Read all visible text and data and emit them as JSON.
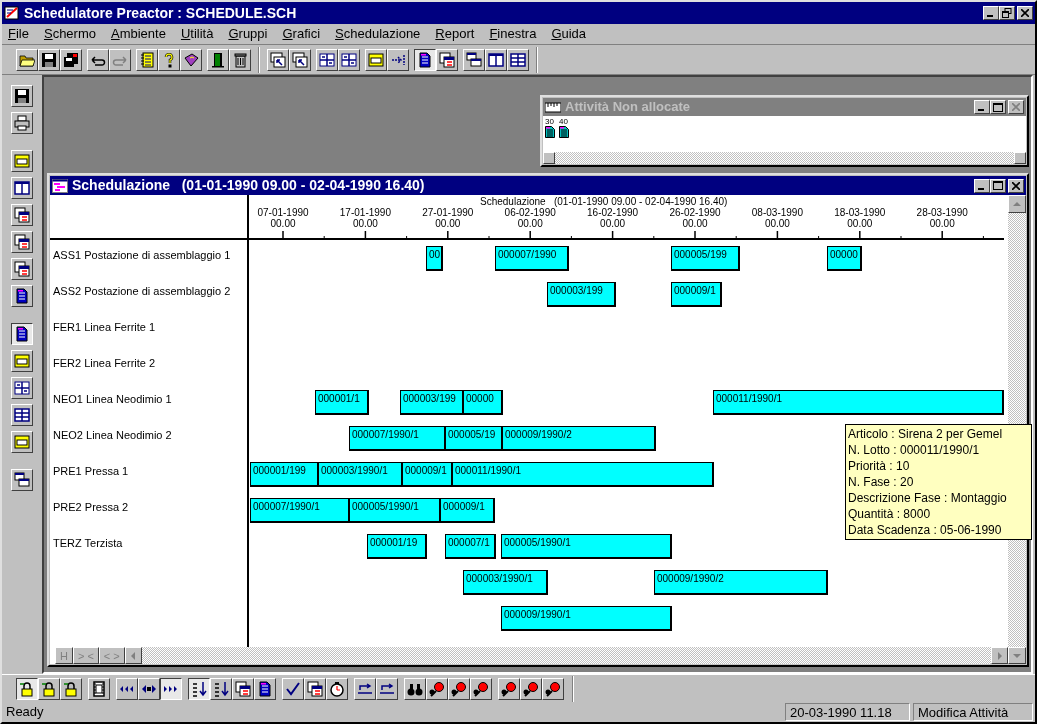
{
  "window": {
    "title": "Schedulatore Preactor : SCHEDULE.SCH"
  },
  "menu": [
    "File",
    "Schermo",
    "Ambiente",
    "Utilità",
    "Gruppi",
    "Grafici",
    "Schedulazione",
    "Report",
    "Finestra",
    "Guida"
  ],
  "toolbar": [
    {
      "pressed": false
    },
    {
      "pressed": false
    },
    {
      "pressed": false
    },
    {
      "pressed": false
    },
    {
      "pressed": false
    },
    {
      "pressed": false
    },
    {
      "pressed": false
    },
    {
      "pressed": false
    },
    {
      "pressed": false
    },
    {
      "pressed": false
    },
    {
      "pressed": false
    },
    {
      "pressed": false
    },
    {
      "pressed": false
    },
    {
      "pressed": false
    },
    {
      "pressed": false
    },
    {
      "pressed": false
    },
    {
      "pressed": true
    },
    {
      "pressed": false
    },
    {
      "pressed": false
    },
    {
      "pressed": false
    },
    {
      "pressed": false
    }
  ],
  "side_toolbar": [
    {
      "pressed": false
    },
    {
      "pressed": false
    },
    {
      "pressed": false
    },
    {
      "pressed": false
    },
    {
      "pressed": false
    },
    {
      "pressed": false
    },
    {
      "pressed": false
    },
    {
      "pressed": false
    },
    {
      "pressed": true
    },
    {
      "pressed": false
    },
    {
      "pressed": false
    },
    {
      "pressed": false
    },
    {
      "pressed": false
    },
    {
      "pressed": false
    }
  ],
  "unallocated_window": {
    "title": "Attività Non allocate",
    "items": [
      {
        "label": "30"
      },
      {
        "label": "40"
      }
    ]
  },
  "schedule_window": {
    "title": "Schedulazione   (01-01-1990 09.00 - 02-04-1990 16.40)",
    "timeline_title": "Schedulazione   (01-01-1990 09.00 - 02-04-1990 16.40)",
    "dates": [
      {
        "date": "07-01-1990",
        "time": "00.00"
      },
      {
        "date": "17-01-1990",
        "time": "00.00"
      },
      {
        "date": "27-01-1990",
        "time": "00.00"
      },
      {
        "date": "06-02-1990",
        "time": "00.00"
      },
      {
        "date": "16-02-1990",
        "time": "00.00"
      },
      {
        "date": "26-02-1990",
        "time": "00.00"
      },
      {
        "date": "08-03-1990",
        "time": "00.00"
      },
      {
        "date": "18-03-1990",
        "time": "00.00"
      },
      {
        "date": "28-03-1990",
        "time": "00.00"
      }
    ],
    "lanes": [
      {
        "resource": "ASS1 Postazione di assemblaggio 1",
        "bars": [
          {
            "label": "00"
          },
          {
            "label": "000007/1990"
          },
          {
            "label": "000005/199"
          },
          {
            "label": "00000"
          }
        ]
      },
      {
        "resource": "ASS2 Postazione di assemblaggio 2",
        "bars": [
          {
            "label": "000003/199"
          },
          {
            "label": "000009/1"
          }
        ]
      },
      {
        "resource": "FER1 Linea Ferrite 1"
      },
      {
        "resource": "FER2 Linea Ferrite 2"
      },
      {
        "resource": "NEO1 Linea Neodimio 1",
        "bars": [
          {
            "label": "000001/1"
          },
          {
            "label": "000003/199"
          },
          {
            "label": "00000"
          },
          {
            "label": "000011/1990/1"
          }
        ]
      },
      {
        "resource": "NEO2 Linea Neodimio 2",
        "bars": [
          {
            "label": "000007/1990/1"
          },
          {
            "label": "000005/19"
          },
          {
            "label": "000009/1990/2"
          }
        ]
      },
      {
        "resource": "PRE1 Pressa 1",
        "bars": [
          {
            "label": "000001/199"
          },
          {
            "label": "000003/1990/1"
          },
          {
            "label": "000009/1"
          },
          {
            "label": "000011/1990/1"
          }
        ]
      },
      {
        "resource": "PRE2 Pressa 2",
        "bars": [
          {
            "label": "000007/1990/1"
          },
          {
            "label": "000005/1990/1"
          },
          {
            "label": "000009/1"
          }
        ]
      },
      {
        "resource": "TERZ Terzista",
        "bars": [
          {
            "label": "000001/19"
          },
          {
            "label": "000007/1"
          },
          {
            "label": "000005/1990/1"
          }
        ]
      },
      {
        "bars": [
          {
            "label": "000003/1990/1"
          },
          {
            "label": "000009/1990/2"
          }
        ]
      },
      {
        "bars": [
          {
            "label": "000009/1990/1"
          }
        ]
      }
    ],
    "tooltip": [
      "Articolo : Sirena 2 per Gemel",
      "N. Lotto : 000011/1990/1",
      "Priorità : 10",
      "N. Fase : 20",
      "Descrizione Fase : Montaggio",
      "Quantità : 8000",
      "Data Scadenza : 05-06-1990"
    ],
    "nav_buttons": [
      "H",
      "> <",
      "< >"
    ]
  },
  "bottom_toolbar": [
    {
      "pressed": true
    },
    {
      "pressed": false
    },
    {
      "pressed": false
    },
    {
      "pressed": false
    },
    {
      "pressed": false
    },
    {
      "pressed": false
    },
    {
      "pressed": true
    },
    {
      "pressed": true
    },
    {
      "pressed": false
    },
    {
      "pressed": false
    },
    {
      "pressed": false
    },
    {
      "pressed": false
    },
    {
      "pressed": false
    },
    {
      "pressed": false
    },
    {
      "pressed": false
    },
    {
      "pressed": false
    },
    {
      "pressed": false
    },
    {
      "pressed": false
    },
    {
      "pressed": false
    },
    {
      "pressed": false
    },
    {
      "pressed": false
    },
    {
      "pressed": false
    },
    {
      "pressed": false
    }
  ],
  "status_bar": {
    "message": "Ready",
    "datetime": "20-03-1990 11.18",
    "mode": "Modifica Attività"
  }
}
